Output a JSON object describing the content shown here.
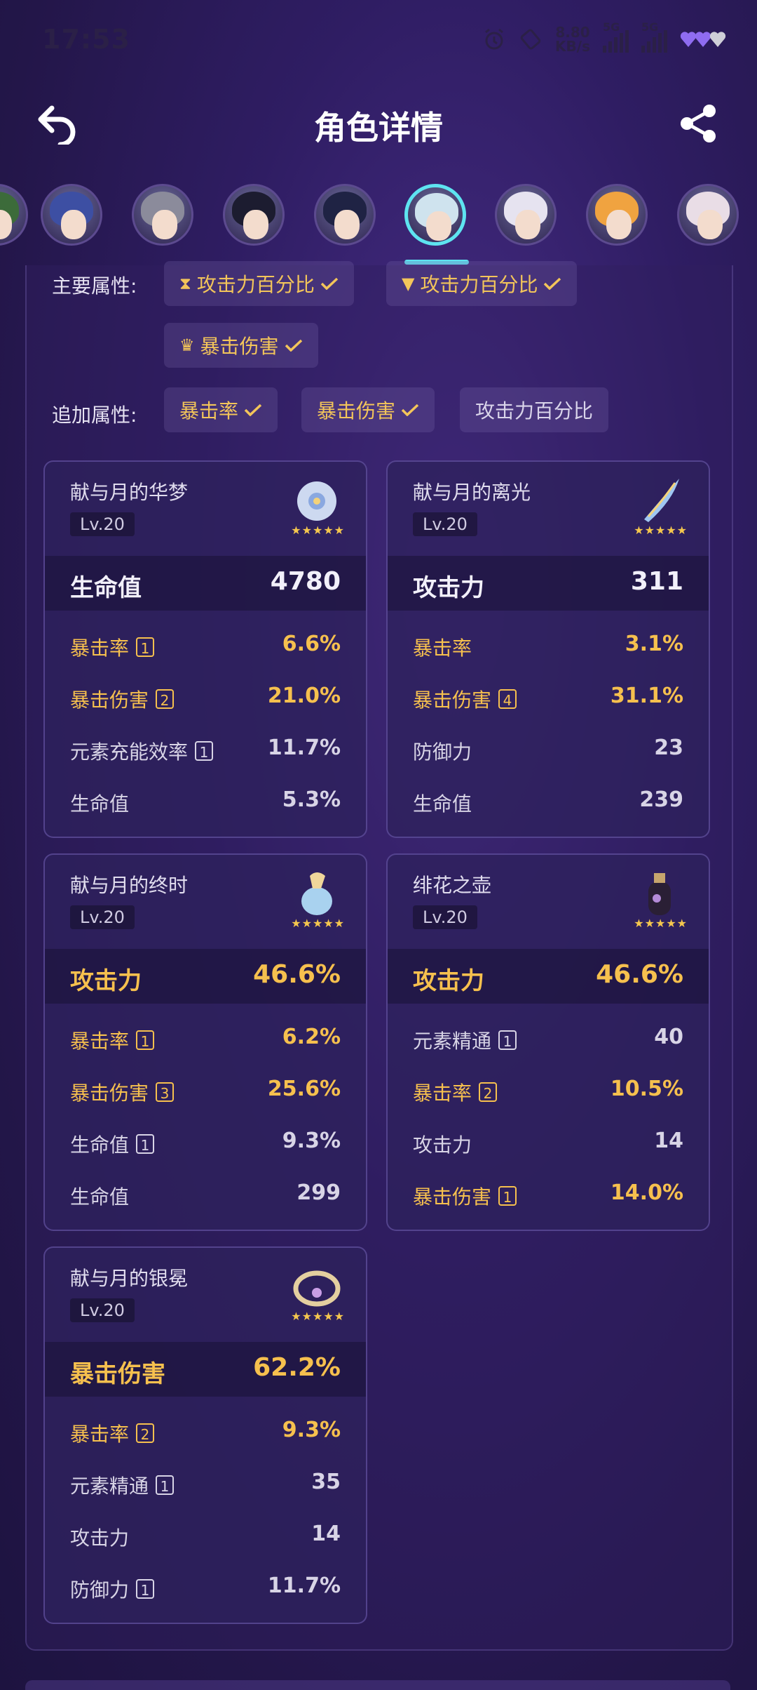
{
  "status": {
    "time": "17:53",
    "speed_value": "8.80",
    "speed_unit": "KB/s",
    "network1": "5G",
    "network2": "5G"
  },
  "header": {
    "title": "角色详情"
  },
  "avatars": [
    {
      "id": "av0",
      "color": "#3c6b3a"
    },
    {
      "id": "av1",
      "color": "#3d4fa3"
    },
    {
      "id": "av2",
      "color": "#8b8b9b"
    },
    {
      "id": "av3",
      "color": "#1c1c30"
    },
    {
      "id": "av4",
      "color": "#1f2344"
    },
    {
      "id": "av5",
      "color": "#cfe3ee"
    },
    {
      "id": "av6",
      "color": "#e6e3f0"
    },
    {
      "id": "av7",
      "color": "#f0a340"
    },
    {
      "id": "av8",
      "color": "#e9dde6"
    }
  ],
  "attributes": {
    "main_label": "主要属性:",
    "main_chips": [
      "攻击力百分比",
      "攻击力百分比",
      "暴击伤害"
    ],
    "extra_label": "追加属性:",
    "extra_chips": [
      "暴击率",
      "暴击伤害",
      "攻击力百分比"
    ]
  },
  "artifacts": [
    {
      "name": "献与月的华梦",
      "level": "Lv.20",
      "stars": "★★★★★",
      "main": {
        "key": "生命值",
        "value": "4780",
        "highlight": false
      },
      "subs": [
        {
          "key": "暴击率",
          "count": "1",
          "value": "6.6%",
          "highlight": true
        },
        {
          "key": "暴击伤害",
          "count": "2",
          "value": "21.0%",
          "highlight": true
        },
        {
          "key": "元素充能效率",
          "count": "1",
          "value": "11.7%",
          "highlight": false
        },
        {
          "key": "生命值",
          "count": "",
          "value": "5.3%",
          "highlight": false
        }
      ]
    },
    {
      "name": "献与月的离光",
      "level": "Lv.20",
      "stars": "★★★★★",
      "main": {
        "key": "攻击力",
        "value": "311",
        "highlight": false
      },
      "subs": [
        {
          "key": "暴击率",
          "count": "",
          "value": "3.1%",
          "highlight": true
        },
        {
          "key": "暴击伤害",
          "count": "4",
          "value": "31.1%",
          "highlight": true
        },
        {
          "key": "防御力",
          "count": "",
          "value": "23",
          "highlight": false
        },
        {
          "key": "生命值",
          "count": "",
          "value": "239",
          "highlight": false
        }
      ]
    },
    {
      "name": "献与月的终时",
      "level": "Lv.20",
      "stars": "★★★★★",
      "main": {
        "key": "攻击力",
        "value": "46.6%",
        "highlight": true
      },
      "subs": [
        {
          "key": "暴击率",
          "count": "1",
          "value": "6.2%",
          "highlight": true
        },
        {
          "key": "暴击伤害",
          "count": "3",
          "value": "25.6%",
          "highlight": true
        },
        {
          "key": "生命值",
          "count": "1",
          "value": "9.3%",
          "highlight": false
        },
        {
          "key": "生命值",
          "count": "",
          "value": "299",
          "highlight": false
        }
      ]
    },
    {
      "name": "绯花之壶",
      "level": "Lv.20",
      "stars": "★★★★★",
      "main": {
        "key": "攻击力",
        "value": "46.6%",
        "highlight": true
      },
      "subs": [
        {
          "key": "元素精通",
          "count": "1",
          "value": "40",
          "highlight": false
        },
        {
          "key": "暴击率",
          "count": "2",
          "value": "10.5%",
          "highlight": true
        },
        {
          "key": "攻击力",
          "count": "",
          "value": "14",
          "highlight": false
        },
        {
          "key": "暴击伤害",
          "count": "1",
          "value": "14.0%",
          "highlight": true
        }
      ]
    },
    {
      "name": "献与月的银冕",
      "level": "Lv.20",
      "stars": "★★★★★",
      "main": {
        "key": "暴击伤害",
        "value": "62.2%",
        "highlight": true
      },
      "subs": [
        {
          "key": "暴击率",
          "count": "2",
          "value": "9.3%",
          "highlight": true
        },
        {
          "key": "元素精通",
          "count": "1",
          "value": "35",
          "highlight": false
        },
        {
          "key": "攻击力",
          "count": "",
          "value": "14",
          "highlight": false
        },
        {
          "key": "防御力",
          "count": "1",
          "value": "11.7%",
          "highlight": false
        }
      ]
    }
  ]
}
